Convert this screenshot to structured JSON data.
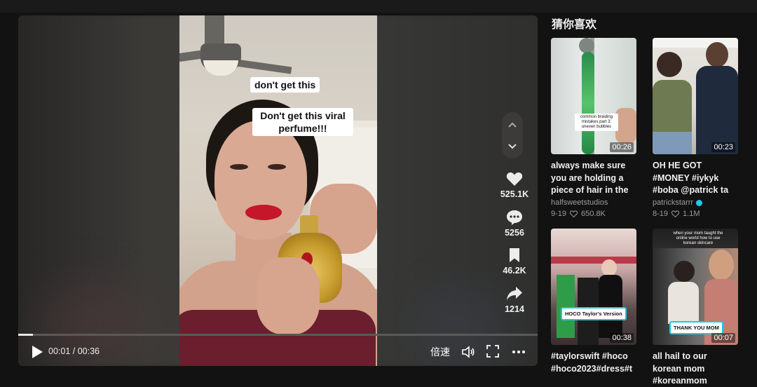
{
  "player": {
    "captions": [
      "don't get this",
      "Don't get this viral perfume!!!"
    ],
    "actions": {
      "likes": "525.1K",
      "comments": "5256",
      "saves": "46.2K",
      "shares": "1214"
    },
    "progress_fraction": 0.028,
    "time_display": "00:01 / 00:36",
    "speed_label": "倍速"
  },
  "sidebar": {
    "title": "猜你喜欢",
    "cards": [
      {
        "duration": "00:26",
        "title": "always make sure you are holding a piece of hair in the center of...",
        "author": "halfsweetstudios",
        "date": "9-19",
        "likes": "650.8K",
        "overlay": "common braiding mistakes part 3: uneven bubbles"
      },
      {
        "duration": "00:23",
        "title": "OH HE GOT #MONEY #iykyk #boba @patrick ta",
        "author": "patrickstarrr",
        "verified": true,
        "date": "8-19",
        "likes": "1.1M"
      },
      {
        "duration": "00:38",
        "title": "#taylorswift #hoco #hoco2023#dress#t",
        "sticker": "HOCO Taylor's Version"
      },
      {
        "duration": "00:07",
        "title": "all hail to our korean mom #koreanmom",
        "sticker": "THANK YOU MOM",
        "overlay": "when your mom taught the online world how to use korean skincare"
      }
    ]
  },
  "colors": {
    "background": "#121212",
    "lips": "#c4172a",
    "verified": "#20c7e8",
    "sticker_border": "#1ec8e0"
  }
}
